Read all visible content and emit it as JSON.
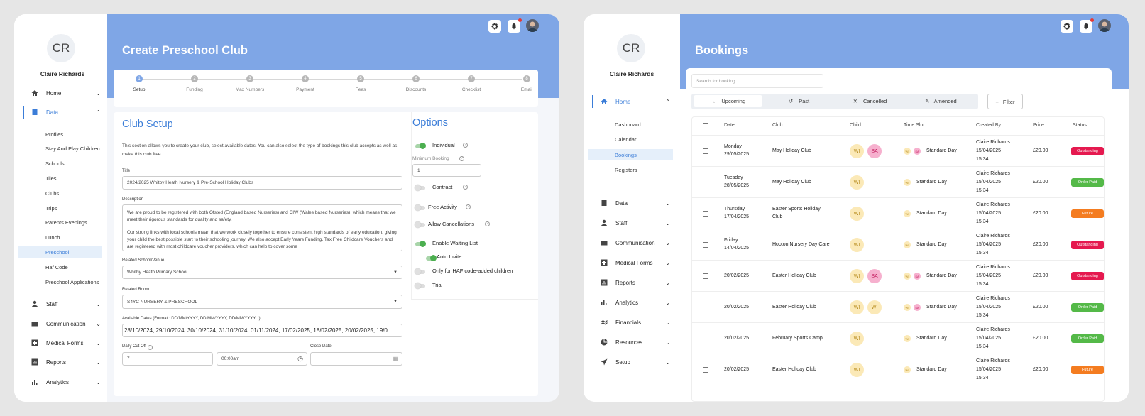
{
  "left": {
    "user": {
      "initials": "CR",
      "name": "Claire Richards"
    },
    "nav": {
      "home": "Home",
      "data": "Data",
      "data_items": [
        "Profiles",
        "Stay And Play Children",
        "Schools",
        "Tiles",
        "Clubs",
        "Trips",
        "Parents Evenings",
        "Lunch",
        "Preschool",
        "Haf Code",
        "Preschool Applications"
      ],
      "staff": "Staff",
      "communication": "Communication",
      "medical_forms": "Medical Forms",
      "reports": "Reports",
      "analytics": "Analytics"
    },
    "page_title": "Create Preschool Club",
    "steps": [
      {
        "n": "1",
        "label": "Setup"
      },
      {
        "n": "2",
        "label": "Funding"
      },
      {
        "n": "3",
        "label": "Max Numbers"
      },
      {
        "n": "4",
        "label": "Payment"
      },
      {
        "n": "5",
        "label": "Fees"
      },
      {
        "n": "6",
        "label": "Discounts"
      },
      {
        "n": "7",
        "label": "Checklist"
      },
      {
        "n": "8",
        "label": "Email"
      }
    ],
    "form": {
      "heading": "Club Setup",
      "intro": "This section allows you to create your club, select available dates. You can also select the type of bookings this club accepts as well as make this club free.",
      "title_label": "Title",
      "title_value": "2024/2025 Whitby Heath Nursery & Pre-School Holiday Clubs",
      "description_label": "Description",
      "description_p1": "We are proud to be registered with both Ofsted (England based Nurseries) and CIW (Wales based Nurseries), which means that we meet their rigorous standards for quality and safety.",
      "description_p2": "Our strong links with local schools mean that we work closely together to ensure consistent high standards of early education, giving your child the best possible start to their schooling journey. We also accept Early Years Funding, Tax Free Childcare Vouchers and are registered with most childcare voucher providers, which can help to cover some",
      "school_label": "Related School/Venue",
      "school_value": "Whitby Heath Primary School",
      "room_label": "Related Room",
      "room_value": "S4YC NURSERY & PRESCHOOL",
      "dates_label": "Available Dates (Format : DD/MM/YYYY, DD/MM/YYYY, DD/MM/YYYY...)",
      "dates_value": "28/10/2024, 29/10/2024, 30/10/2024, 31/10/2024, 01/11/2024, 17/02/2025, 18/02/2025, 20/02/2025, 19/0",
      "cutoff_label": "Daily Cut Off",
      "cutoff_days": "7",
      "cutoff_time": "00:00am",
      "close_label": "Close Date"
    },
    "options": {
      "heading": "Options",
      "individual": "Individual",
      "min_booking_label": "Minimum Booking",
      "min_booking_value": "1",
      "contract": "Contract",
      "free_activity": "Free Activity",
      "allow_cancellations": "Allow Cancellations",
      "enable_waiting_list": "Enable Waiting List",
      "auto_invite": "Auto Invite",
      "haf_only": "Only for HAF code-added children",
      "trial": "Trial"
    }
  },
  "right": {
    "user": {
      "initials": "CR",
      "name": "Claire Richards"
    },
    "nav": {
      "home": "Home",
      "home_items": [
        "Dashboard",
        "Calendar",
        "Bookings",
        "Registers"
      ],
      "data": "Data",
      "staff": "Staff",
      "communication": "Communication",
      "medical_forms": "Medical Forms",
      "reports": "Reports",
      "analytics": "Analytics",
      "financials": "Financials",
      "resources": "Resources",
      "setup": "Setup"
    },
    "page_title": "Bookings",
    "search_placeholder": "Search for booking",
    "tabs": {
      "upcoming": "Upcoming",
      "past": "Past",
      "cancelled": "Cancelled",
      "amended": "Amended"
    },
    "filter": "Filter",
    "columns": {
      "date": "Date",
      "club": "Club",
      "child": "Child",
      "slot": "Time Slot",
      "created": "Created By",
      "price": "Price",
      "status": "Status"
    },
    "rows": [
      {
        "date1": "Monday",
        "date2": "29/05/2025",
        "club1": "May Holiday Club",
        "club2": "",
        "kids": [
          "WI",
          "SA"
        ],
        "minis": [
          "WI",
          "SA"
        ],
        "slot": "Standard Day",
        "by": "Claire Richards",
        "at1": "15/04/2025",
        "at2": "15:34",
        "price": "£20.00",
        "status": "Outstanding"
      },
      {
        "date1": "Tuesday",
        "date2": "28/05/2025",
        "club1": "May Holiday Club",
        "club2": "",
        "kids": [
          "WI"
        ],
        "minis": [
          "WI"
        ],
        "slot": "Standard Day",
        "by": "Claire Richards",
        "at1": "15/04/2025",
        "at2": "15:34",
        "price": "£20.00",
        "status": "Order Paid"
      },
      {
        "date1": "Thursday",
        "date2": "17/04/2025",
        "club1": "Easter Sports Holiday",
        "club2": "Club",
        "kids": [
          "WI"
        ],
        "minis": [
          "WI"
        ],
        "slot": "Standard Day",
        "by": "Claire Richards",
        "at1": "15/04/2025",
        "at2": "15:34",
        "price": "£20.00",
        "status": "Future"
      },
      {
        "date1": "Friday",
        "date2": "14/04/2025",
        "club1": "Hooton Nursery Day Care",
        "club2": "",
        "kids": [
          "WI"
        ],
        "minis": [
          "WI"
        ],
        "slot": "Standard Day",
        "by": "Claire Richards",
        "at1": "15/04/2025",
        "at2": "15:34",
        "price": "£20.00",
        "status": "Outstanding"
      },
      {
        "date1": "20/02/2025",
        "date2": "",
        "club1": "Easter Holiday Club",
        "club2": "",
        "kids": [
          "WI",
          "SA"
        ],
        "minis": [
          "WI",
          "SA"
        ],
        "slot": "Standard Day",
        "by": "Claire Richards",
        "at1": "15/04/2025",
        "at2": "15:34",
        "price": "£20.00",
        "status": "Outstanding"
      },
      {
        "date1": "20/02/2025",
        "date2": "",
        "club1": "Easter Holiday Club",
        "club2": "",
        "kids": [
          "WI",
          "WI"
        ],
        "minis": [
          "WI",
          "SA"
        ],
        "slot": "Standard Day",
        "by": "Claire Richards",
        "at1": "15/04/2025",
        "at2": "15:34",
        "price": "£20.00",
        "status": "Order Paid"
      },
      {
        "date1": "20/02/2025",
        "date2": "",
        "club1": "February Sports Camp",
        "club2": "",
        "kids": [
          "WI"
        ],
        "minis": [
          "WI"
        ],
        "slot": "Standard Day",
        "by": "Claire Richards",
        "at1": "15/04/2025",
        "at2": "15:34",
        "price": "£20.00",
        "status": "Order Paid"
      },
      {
        "date1": "20/02/2025",
        "date2": "",
        "club1": "Easter Holiday Club",
        "club2": "",
        "kids": [
          "WI"
        ],
        "minis": [
          "WI"
        ],
        "slot": "Standard Day",
        "by": "Claire Richards",
        "at1": "15/04/2025",
        "at2": "15:34",
        "price": "£20.00",
        "status": "Future"
      }
    ],
    "status_colors": {
      "Outstanding": "#e5194f",
      "Order Paid": "#54b948",
      "Future": "#f47c20"
    }
  }
}
